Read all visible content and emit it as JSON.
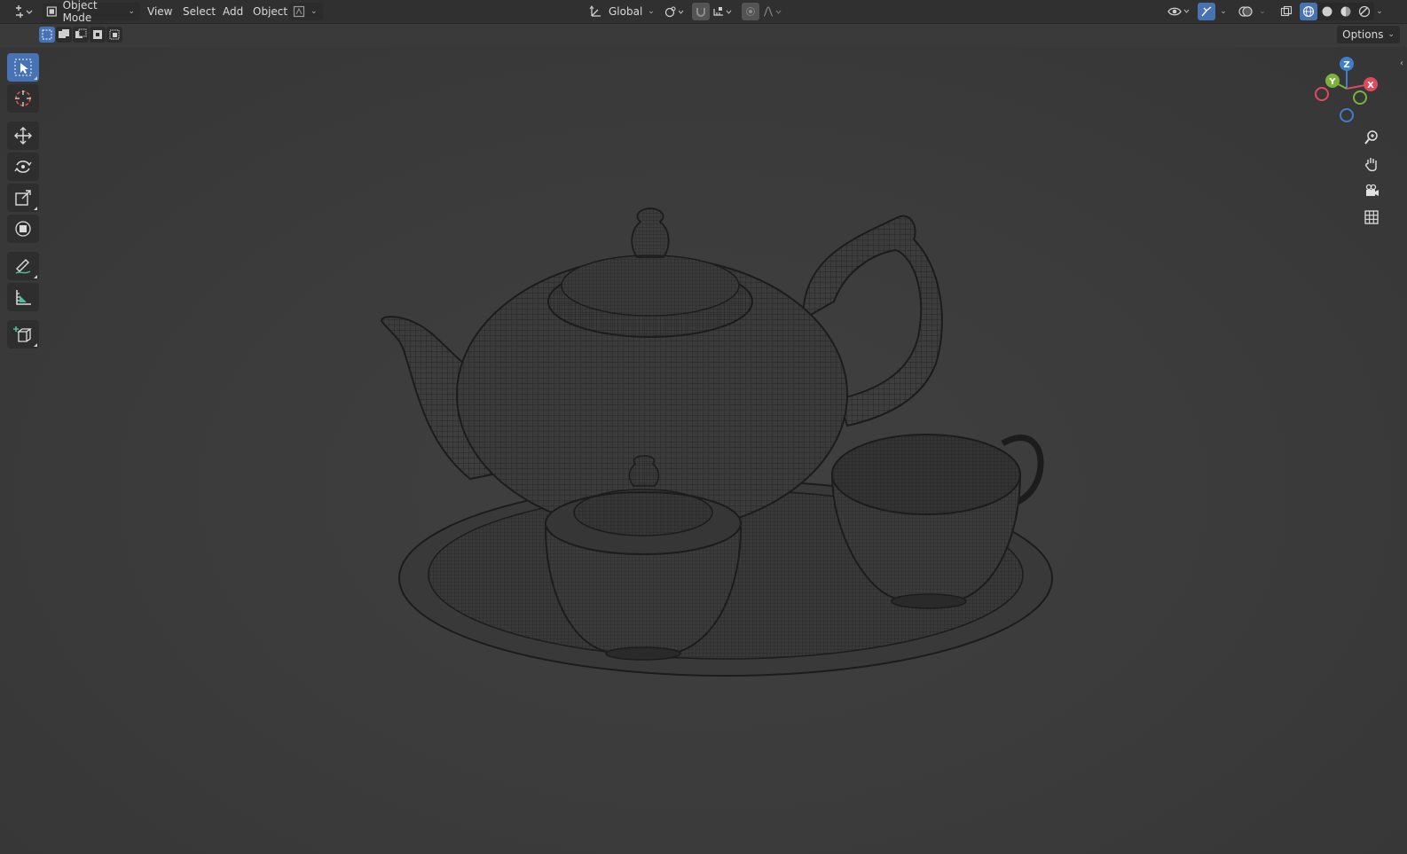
{
  "header": {
    "mode": {
      "label": "Object Mode",
      "icon": "object-mode-icon"
    },
    "menus": [
      "View",
      "Select",
      "Add",
      "Object"
    ],
    "transform_orientation": {
      "label": "Global",
      "icon": "orientation-icon"
    },
    "editor_type_icon": "editor-type-icon"
  },
  "subbar": {
    "selection_modes": [
      "select-new",
      "select-extend",
      "select-subtract",
      "select-invert",
      "select-intersect"
    ],
    "options_label": "Options"
  },
  "toolbar": {
    "tools": [
      "select-box",
      "cursor",
      "move",
      "rotate",
      "scale",
      "transform",
      "annotate",
      "measure",
      "add-cube"
    ],
    "active": "select-box"
  },
  "gizmo": {
    "x_label": "X",
    "y_label": "Y",
    "z_label": "Z"
  },
  "colors": {
    "accent": "#4772b3",
    "axis_x": "#e04a5f",
    "axis_y": "#7ab23a",
    "axis_z": "#3f7ecb",
    "background": "#3a3a3a",
    "header": "#303030"
  },
  "viewport": {
    "shading": "wireframe",
    "scene": "teapot-set"
  }
}
